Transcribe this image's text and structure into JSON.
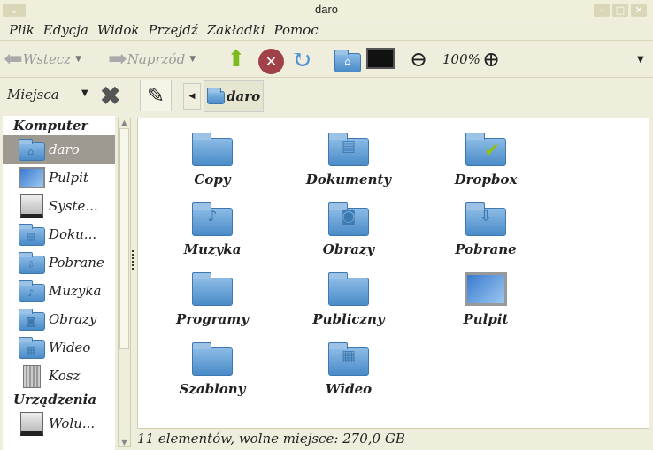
{
  "window": {
    "title": "daro"
  },
  "menu": [
    "Plik",
    "Edycja",
    "Widok",
    "Przejdź",
    "Zakładki",
    "Pomoc"
  ],
  "toolbar": {
    "back": "Wstecz",
    "forward": "Naprzód",
    "zoom": "100%"
  },
  "location": {
    "places_label": "Miejsca",
    "crumb": "daro"
  },
  "sidebar": {
    "computer_header": "Komputer",
    "computer_items": [
      {
        "label": "daro",
        "icon": "home-folder-icon",
        "glyph": "⌂"
      },
      {
        "label": "Pulpit",
        "icon": "desktop-icon",
        "glyph": ""
      },
      {
        "label": "Syste...",
        "icon": "drive-icon",
        "glyph": ""
      },
      {
        "label": "Doku...",
        "icon": "documents-folder-icon",
        "glyph": "▤"
      },
      {
        "label": "Pobrane",
        "icon": "downloads-folder-icon",
        "glyph": "⇩"
      },
      {
        "label": "Muzyka",
        "icon": "music-folder-icon",
        "glyph": "♪"
      },
      {
        "label": "Obrazy",
        "icon": "pictures-folder-icon",
        "glyph": "◙"
      },
      {
        "label": "Wideo",
        "icon": "videos-folder-icon",
        "glyph": "▦"
      },
      {
        "label": "Kosz",
        "icon": "trash-icon",
        "glyph": ""
      }
    ],
    "devices_header": "Urządzenia",
    "device_items": [
      {
        "label": "Wolu...",
        "icon": "drive-icon",
        "glyph": ""
      }
    ]
  },
  "files": [
    {
      "label": "Copy",
      "glyph": ""
    },
    {
      "label": "Dokumenty",
      "glyph": "▤"
    },
    {
      "label": "Dropbox",
      "glyph": "✔"
    },
    {
      "label": "Muzyka",
      "glyph": "♪"
    },
    {
      "label": "Obrazy",
      "glyph": "◙"
    },
    {
      "label": "Pobrane",
      "glyph": "⇩"
    },
    {
      "label": "Programy",
      "glyph": ""
    },
    {
      "label": "Publiczny",
      "glyph": ""
    },
    {
      "label": "Pulpit",
      "glyph": "desktop"
    },
    {
      "label": "Szablony",
      "glyph": ""
    },
    {
      "label": "Wideo",
      "glyph": "▦"
    }
  ],
  "status": "11 elementów, wolne miejsce: 270,0 GB"
}
